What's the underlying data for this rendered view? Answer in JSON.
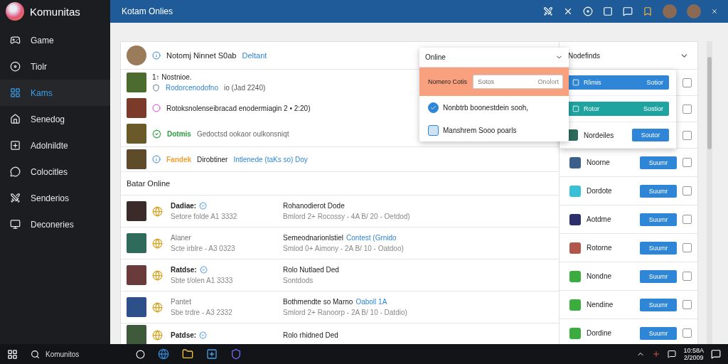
{
  "sidebar": {
    "brand": "Komunitas",
    "items": [
      {
        "label": "Game",
        "selected": false
      },
      {
        "label": "Tiolr",
        "selected": false
      },
      {
        "label": "Kams",
        "selected": true
      },
      {
        "label": "Senedog",
        "selected": false
      },
      {
        "label": "Adolnildte",
        "selected": false
      },
      {
        "label": "Colocitles",
        "selected": false
      },
      {
        "label": "Senderios",
        "selected": false
      },
      {
        "label": "Deconeries",
        "selected": false
      }
    ]
  },
  "topbar": {
    "title": "Kotam Onlies"
  },
  "feed": {
    "header": {
      "title": "Notomj Ninnet S0ab",
      "link": "Deltant"
    },
    "group": [
      {
        "kind": "two-line",
        "title": "1↑ Nostnioe.",
        "link": "Rodorcenodofno",
        "text": "io (Jad 2240)"
      },
      {
        "kind": "line",
        "text": "Rotoksnolenseibracad enodermiagin 2 • 2:20)"
      },
      {
        "kind": "status",
        "highlight": "Dotmis",
        "color": "#2e9d3f",
        "text": "Gedoctsd ookaor oulkonsniqt"
      }
    ],
    "notice": {
      "highlight": "Fandek",
      "color": "#f0a030",
      "text": "Dirobtiner",
      "link": "Intlenede (taKs so) Doy"
    },
    "section": "Batar Online",
    "friends": [
      {
        "name": "Dadiae:",
        "verified": true,
        "status": "Setore folde A1 3332",
        "title": "Rohanodierot Dode",
        "detail": "Bmlord 2+ Rocossy - 4A B/ 20 - Oetdod)"
      },
      {
        "name": "Alaner",
        "verified": false,
        "status": "Scte irblre - A3 0323",
        "title": "Semeodnarionlstiel",
        "link": "Contest (Grnido",
        "detail": "Smlod 0+ Aimony - 2A B/ 10 - Oatdoo)"
      },
      {
        "name": "Ratdse:",
        "verified": true,
        "status": "Sbte t/olen A1 3333",
        "title": "Rolo Nutlaed Ded",
        "detail": "Sontdods"
      },
      {
        "name": "Pantet",
        "verified": false,
        "status": "Sbe trdre - A3 2332",
        "title": "Bothmendte so Marno",
        "link": "Oaboll 1A",
        "detail": "Smlord 2+ Ranoorp - 2A B/ 10 - Datdio)"
      },
      {
        "name": "Patdse:",
        "verified": true,
        "title": "Rolo rhidned Ded"
      }
    ]
  },
  "dropdown": {
    "title": "Online",
    "label": "Nomero Cotis",
    "field": {
      "placeholder": "Sotos",
      "suffix": "Onolort"
    },
    "options": [
      {
        "label": "Nonbtrb boonestdein sooh,",
        "checked": true
      },
      {
        "label": "Manshrem Sooo poarls",
        "checked": false
      }
    ]
  },
  "right": {
    "title": "Nodefinds",
    "popover": [
      {
        "kind": "bar",
        "label": "Rlimis",
        "action": "Sotior",
        "color": "#2f86d6"
      },
      {
        "kind": "bar",
        "label": "Rotor",
        "action": "Sostior",
        "color": "#1fa3a0"
      },
      {
        "kind": "app",
        "label": "Nordeiles",
        "action": "Soutor"
      }
    ],
    "rows": [
      {
        "checked": false
      },
      {
        "checked": false
      },
      {
        "checked": false
      },
      {
        "name": "Noorne",
        "action": "Suumr",
        "checked": false
      },
      {
        "name": "Dordote",
        "action": "Suumr",
        "checked": false
      },
      {
        "name": "Aotdme",
        "action": "Suumr",
        "checked": false
      },
      {
        "name": "Rotorne",
        "action": "Suumr",
        "checked": false
      },
      {
        "name": "Nondne",
        "action": "Suumr",
        "checked": false
      },
      {
        "name": "Nendine",
        "action": "Suumr",
        "checked": false
      },
      {
        "name": "Dordine",
        "action": "Suumr",
        "checked": false
      }
    ]
  },
  "taskbar": {
    "search": "Komunitos",
    "time": "10:58A",
    "date": "2/2009"
  }
}
